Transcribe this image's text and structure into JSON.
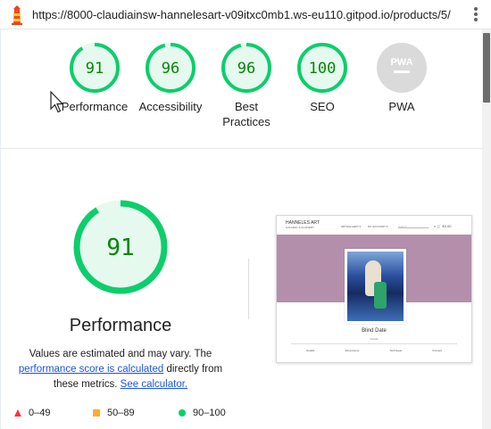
{
  "topbar": {
    "url": "https://8000-claudiainsw-hannelesart-v09itxc0mb1.ws-eu110.gitpod.io/products/5/",
    "logo_icon": "lighthouse-icon",
    "menu_icon": "kebab-menu-icon"
  },
  "colors": {
    "pass": "#0cce6b",
    "pass_bg": "#e6f9ef",
    "pass_text": "#008800",
    "average": "#ffaa33",
    "fail": "#ff3333",
    "neutral": "#d9d9d9"
  },
  "summary": {
    "gauges": [
      {
        "score": "91",
        "value": 91,
        "label": "Performance"
      },
      {
        "score": "96",
        "value": 96,
        "label": "Accessibility"
      },
      {
        "score": "96",
        "value": 96,
        "label_line1": "Best",
        "label_line2": "Practices"
      },
      {
        "score": "100",
        "value": 100,
        "label": "SEO"
      },
      {
        "score": "PWA",
        "label": "PWA"
      }
    ]
  },
  "performance": {
    "score": "91",
    "value": 91,
    "title": "Performance",
    "desc_1": "Values are estimated and may vary. The",
    "link_1": "performance score is calculated",
    "desc_2": "directly from these metrics.",
    "link_2": "See calculator."
  },
  "legend": {
    "fail": "0–49",
    "average": "50–89",
    "pass": "90–100"
  },
  "thumbnail": {
    "brand": "HANNELES ART",
    "brand_sub": "GALLERY & ACADEMY",
    "nav": [
      "ARTGALLERY ▾",
      "MY ACCOUNT ▾"
    ],
    "search": "Search",
    "icons": "⌕  🛒",
    "cart_amount": "€0.00",
    "title": "Blind Date",
    "sub": "Details",
    "tabs": [
      "Details",
      "Dimensions",
      "Technique",
      "Framed"
    ]
  }
}
